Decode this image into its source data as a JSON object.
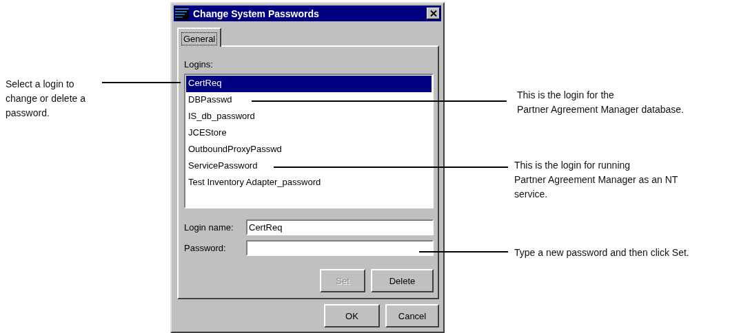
{
  "window": {
    "title": "Change System Passwords"
  },
  "tabs": [
    {
      "label": "General",
      "selected": true
    }
  ],
  "logins": {
    "label": "Logins:",
    "items": [
      {
        "name": "CertReq",
        "selected": true
      },
      {
        "name": "DBPasswd",
        "selected": false
      },
      {
        "name": "IS_db_password",
        "selected": false
      },
      {
        "name": "JCEStore",
        "selected": false
      },
      {
        "name": "OutboundProxyPasswd",
        "selected": false
      },
      {
        "name": "ServicePassword",
        "selected": false
      },
      {
        "name": "Test Inventory Adapter_password",
        "selected": false
      }
    ]
  },
  "fields": [
    {
      "label": "Login name:",
      "value": "CertReq"
    },
    {
      "label": "Password:"
    }
  ],
  "panel_buttons": [
    {
      "label": "Set",
      "disabled": true
    },
    {
      "label": "Delete",
      "disabled": false
    }
  ],
  "dialog_buttons": [
    {
      "label": "OK",
      "disabled": false
    },
    {
      "label": "Cancel",
      "disabled": false
    }
  ],
  "callouts": [
    {
      "lines": [
        "Select a login to",
        "change or delete a",
        "password."
      ]
    },
    {
      "lines": [
        "This is the login for the",
        "Partner Agreement Manager database."
      ]
    },
    {
      "lines": [
        "This is the login for running",
        "Partner Agreement Manager as an NT",
        "service."
      ]
    },
    {
      "lines": [
        "Type a new password and then click Set."
      ]
    }
  ]
}
